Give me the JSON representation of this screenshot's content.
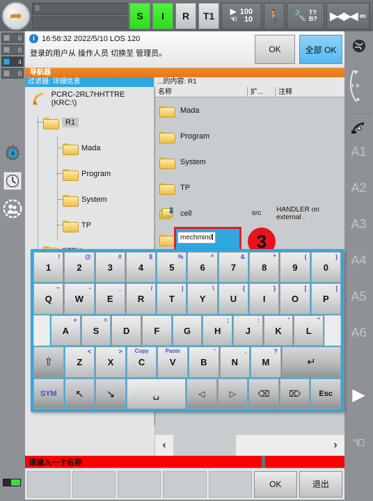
{
  "topbar": {
    "robot_icon": "robot-icon",
    "status_field_1": "0",
    "status_field_2": "",
    "submit_interpreter": "S",
    "drives_i": "I",
    "robot_r": "R",
    "mode": "T1",
    "override_program": "100",
    "override_jog": "10",
    "walk_icon": "walking-man-icon",
    "tool_icon": "tool-icon",
    "tb_top": "T?",
    "tb_bottom": "B?",
    "increment_icon": "increment-icon",
    "infinity_icon": "∞"
  },
  "left_rail": {
    "counters": [
      {
        "icon": "ack-message-icon",
        "count": "0"
      },
      {
        "icon": "status-message-icon",
        "count": "0"
      },
      {
        "icon": "info-message-icon",
        "count": "4"
      },
      {
        "icon": "wait-message-icon",
        "count": "0"
      }
    ],
    "icons": [
      {
        "name": "settings-gear-icon",
        "glyph": "⚙"
      },
      {
        "name": "clock-icon",
        "glyph": "◷"
      },
      {
        "name": "user-group-icon",
        "glyph": "☻"
      }
    ],
    "battery": "battery-indicator"
  },
  "right_rail": {
    "globe_icon": "world-coordinate-icon",
    "jog_mode_icon": "jog-direction-icon",
    "tool_icon": "tool-base-icon",
    "axes": [
      "A1",
      "A2",
      "A3",
      "A4",
      "A5",
      "A6"
    ],
    "play_icon": "play-icon",
    "hand_icon": "hand-jog-icon"
  },
  "notification": {
    "icon": "info-icon",
    "timestamp": "16:58:32 2022/5/10 LOS 120",
    "message": "登录的用户从 操作人员 切换至 管理员。",
    "ok_label": "OK",
    "ok_all_label": "全部 OK"
  },
  "navigator": {
    "title": "导航器",
    "filter_label": "过滤器: 详细信息",
    "content_label": "...的内容: R1"
  },
  "tree": {
    "root": "PCRC-2RL7HHTTRE (KRC:\\)",
    "nodes": [
      {
        "label": "R1",
        "selected": true
      },
      {
        "label": "Mada",
        "selected": false
      },
      {
        "label": "Program",
        "selected": false
      },
      {
        "label": "System",
        "selected": false
      },
      {
        "label": "TP",
        "selected": false
      },
      {
        "label": "STEU",
        "selected": false
      }
    ]
  },
  "file_list": {
    "columns": [
      "名称",
      "扩...",
      "注释"
    ],
    "rows": [
      {
        "name": "Mada",
        "ext": "",
        "comment": "",
        "icon": "folder-icon"
      },
      {
        "name": "Program",
        "ext": "",
        "comment": "",
        "icon": "folder-icon"
      },
      {
        "name": "System",
        "ext": "",
        "comment": "",
        "icon": "folder-icon"
      },
      {
        "name": "TP",
        "ext": "",
        "comment": "",
        "icon": "folder-icon"
      },
      {
        "name": "cell",
        "ext": "src",
        "comment": "HANDLER on external .",
        "icon": "src-file-icon"
      }
    ],
    "new_folder": {
      "icon": "folder-icon",
      "input_value": "mechmind",
      "trailing_text": "---",
      "step_badge": "3"
    }
  },
  "scrollbar": {
    "left_arrow": "‹",
    "right_arrow": "›"
  },
  "status_strip": {
    "message": "请输入一个名称"
  },
  "softkeys": [
    {
      "label": "",
      "raised": false
    },
    {
      "label": "",
      "raised": false
    },
    {
      "label": "",
      "raised": false
    },
    {
      "label": "",
      "raised": false
    },
    {
      "label": "",
      "raised": false
    },
    {
      "label": "OK",
      "raised": true
    },
    {
      "label": "退出",
      "raised": true
    }
  ],
  "keyboard": {
    "rows": [
      [
        {
          "main": "1",
          "alt": "!"
        },
        {
          "main": "2",
          "alt": "@"
        },
        {
          "main": "3",
          "alt": "#"
        },
        {
          "main": "4",
          "alt": "$"
        },
        {
          "main": "5",
          "alt": "%"
        },
        {
          "main": "6",
          "alt": "^"
        },
        {
          "main": "7",
          "alt": "&"
        },
        {
          "main": "8",
          "alt": "*"
        },
        {
          "main": "9",
          "alt": "("
        },
        {
          "main": "0",
          "alt": ")"
        }
      ],
      [
        {
          "main": "Q",
          "alt": "~"
        },
        {
          "main": "W",
          "alt": "-"
        },
        {
          "main": "E",
          "alt": "_"
        },
        {
          "main": "R",
          "alt": "/"
        },
        {
          "main": "T",
          "alt": "|"
        },
        {
          "main": "Y",
          "alt": "\\"
        },
        {
          "main": "U",
          "alt": "{"
        },
        {
          "main": "I",
          "alt": "}"
        },
        {
          "main": "O",
          "alt": "["
        },
        {
          "main": "P",
          "alt": "]"
        }
      ],
      [
        {
          "main": "A",
          "alt": "+"
        },
        {
          "main": "S",
          "alt": "="
        },
        {
          "main": "D",
          "alt": ""
        },
        {
          "main": "F",
          "alt": ""
        },
        {
          "main": "G",
          "alt": ""
        },
        {
          "main": "H",
          "alt": ";"
        },
        {
          "main": "J",
          "alt": ":"
        },
        {
          "main": "K",
          "alt": "'"
        },
        {
          "main": "L",
          "alt": "\""
        }
      ],
      [
        {
          "main": "⇧",
          "alt": "",
          "name": "shift-key"
        },
        {
          "main": "Z",
          "alt": "<"
        },
        {
          "main": "X",
          "alt": ">"
        },
        {
          "main": "C",
          "alt": "Copy"
        },
        {
          "main": "V",
          "alt": "Paste"
        },
        {
          "main": "B",
          "alt": "'"
        },
        {
          "main": "N",
          "alt": "."
        },
        {
          "main": "M",
          "alt": "?"
        },
        {
          "main": "↵",
          "alt": "",
          "name": "enter-key"
        }
      ],
      [
        {
          "main": "SYM",
          "alt": "",
          "name": "symbol-key"
        },
        {
          "main": "↖",
          "alt": "",
          "name": "home-key"
        },
        {
          "main": "↘",
          "alt": "",
          "name": "end-key"
        },
        {
          "main": "␣",
          "alt": "",
          "name": "space-key"
        },
        {
          "main": "◁",
          "alt": "",
          "name": "arrow-left-key"
        },
        {
          "main": "▷",
          "alt": "",
          "name": "arrow-right-key"
        },
        {
          "main": "⌫",
          "alt": "",
          "name": "backspace-key"
        },
        {
          "main": "⌦",
          "alt": "",
          "name": "delete-key"
        },
        {
          "main": "Esc",
          "alt": "",
          "name": "escape-key"
        }
      ]
    ]
  },
  "colors": {
    "accent_orange": "#ef8521",
    "accent_blue": "#2fa8e0",
    "error_red": "#fc0000",
    "drive_green": "#2ddd1b",
    "highlight_red": "#e31e24"
  }
}
